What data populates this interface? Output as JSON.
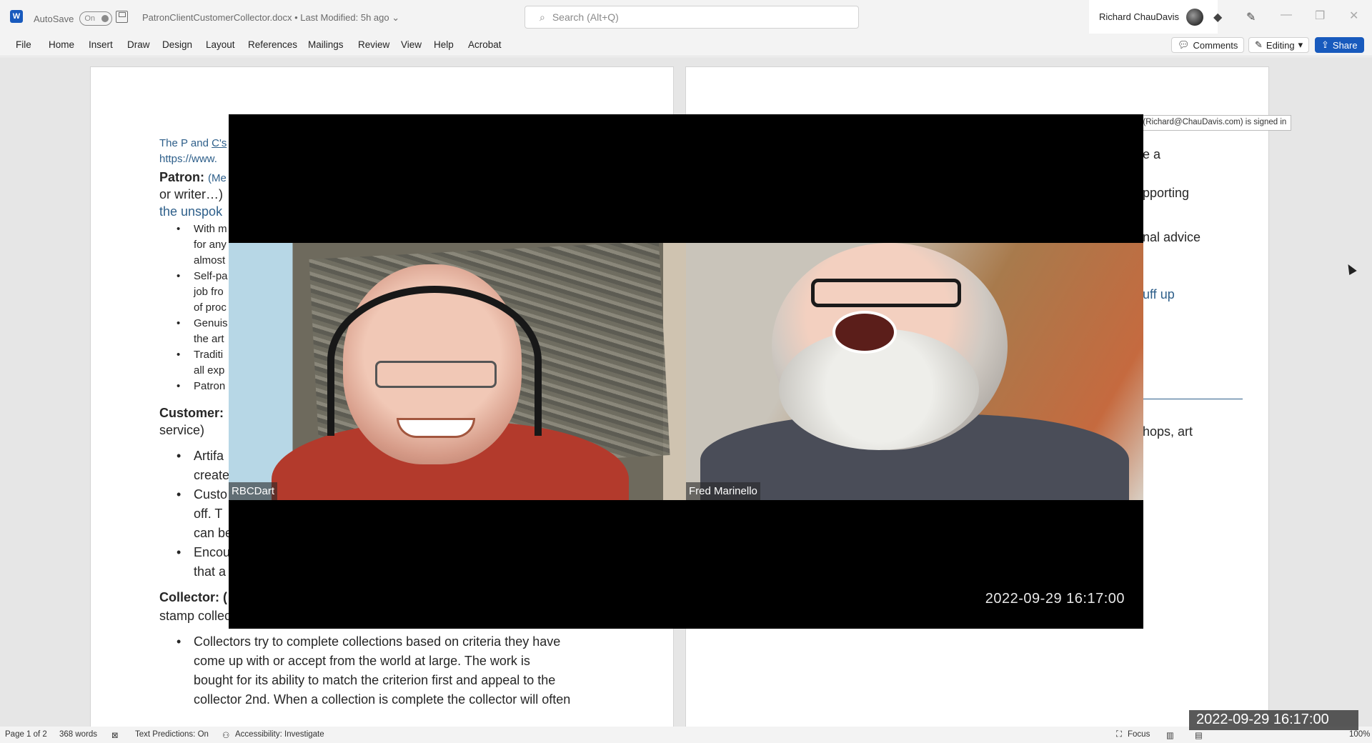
{
  "titlebar": {
    "autosave_label": "AutoSave",
    "autosave_state": "On",
    "document_title": "PatronClientCustomerCollector.docx  •  Last Modified: 5h ago  ⌄",
    "search_placeholder": "Search (Alt+Q)",
    "user_name": "Richard ChauDavis"
  },
  "ribbon": {
    "tabs": [
      "File",
      "Home",
      "Insert",
      "Draw",
      "Design",
      "Layout",
      "References",
      "Mailings",
      "Review",
      "View",
      "Help",
      "Acrobat"
    ],
    "comments_label": "Comments",
    "editing_label": "Editing",
    "share_label": "Share"
  },
  "document": {
    "page1": {
      "line1": "The P and ",
      "line1_link": "C's",
      "line2": "https://www.",
      "patron_heading": "Patron:",
      "patron_note": "(Me",
      "patron_line2": "or writer…)",
      "patron_line3": "the unspok",
      "patron_bullets": [
        "With m",
        "for any",
        "almost",
        "Self-pa",
        "job fro",
        "of proc",
        "Genuis",
        "the art",
        "Traditi",
        "all exp",
        "Patron"
      ],
      "customer_heading": "Customer:",
      "customer_line2": "service)",
      "customer_bullets": [
        "Artifa",
        "create",
        "Custo",
        "off.  T",
        "can be",
        "Encou",
        "that a"
      ],
      "collector_heading": "Collector: (",
      "collector_line2": "stamp collector)",
      "collector_bullet_lines": [
        "Collectors try to complete collections based on criteria they have",
        "come up with or accept from the world at large.  The work is",
        "bought for its ability to match the criterion first and appeal to the",
        "collector 2nd.  When a collection is complete the collector will often"
      ]
    },
    "page2": {
      "fragments": [
        "e a",
        "pporting",
        "nal advice",
        "uff up",
        "hops, art"
      ]
    },
    "signed_in_tooltip": "ChauDavis (Richard@ChauDavis.com) is signed in"
  },
  "video_call": {
    "participants": [
      {
        "name": "RBCDart"
      },
      {
        "name": "Fred Marinello"
      }
    ],
    "timestamp": "2022-09-29  16:17:00"
  },
  "statusbar": {
    "page": "Page 1 of 2",
    "words": "368 words",
    "text_predictions": "Text Predictions: On",
    "accessibility": "Accessibility: Investigate",
    "focus": "Focus",
    "zoom": "100%"
  },
  "overlay_timestamp": "2022-09-29  16:17:00",
  "colors": {
    "accent": "#185abd",
    "link_blue": "#2e5f8a"
  }
}
